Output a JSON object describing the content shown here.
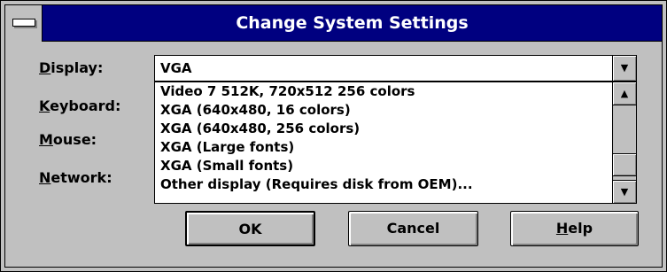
{
  "window": {
    "title": "Change System Settings"
  },
  "fields": {
    "display_label": "Display:",
    "keyboard_label": "Keyboard:",
    "mouse_label": "Mouse:",
    "network_label": "Network:"
  },
  "display_combo": {
    "value": "VGA"
  },
  "dropdown_items": [
    "Video 7 512K, 720x512 256 colors",
    "XGA (640x480, 16 colors)",
    "XGA (640x480, 256 colors)",
    "XGA (Large fonts)",
    "XGA (Small fonts)",
    "Other display (Requires disk from OEM)..."
  ],
  "buttons": {
    "ok": "OK",
    "cancel": "Cancel",
    "help": "Help"
  },
  "icons": {
    "system_menu": "system-menu-icon",
    "combo_arrow": "dropdown-arrow-icon",
    "scroll_up": "scroll-up-arrow-icon",
    "scroll_down": "scroll-down-arrow-icon"
  },
  "colors": {
    "titlebar": "#000080",
    "face": "#c0c0c0"
  }
}
